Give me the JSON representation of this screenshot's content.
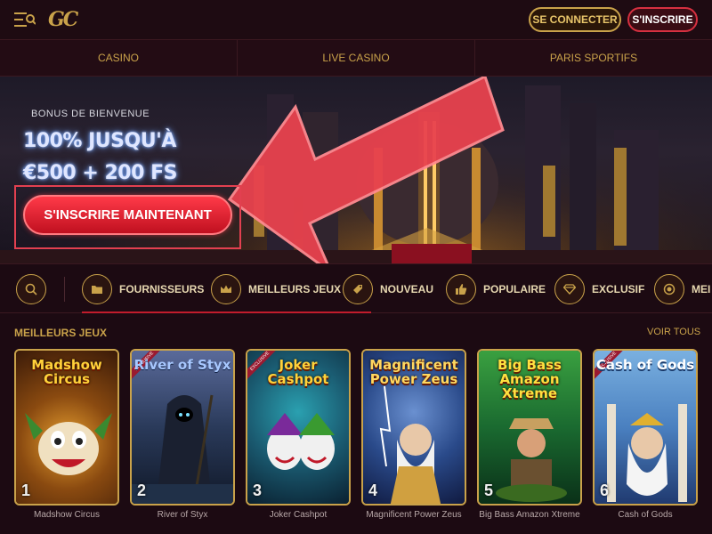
{
  "header": {
    "login_label": "SE CONNECTER",
    "signup_label": "S'INSCRIRE",
    "logo_text": "GC",
    "menu_icon": "menu-icon",
    "colors": {
      "gold": "#c9a24a",
      "red": "#d63040",
      "bg": "#1c0a12"
    }
  },
  "main_nav": {
    "tabs": [
      {
        "label": "CASINO"
      },
      {
        "label": "LIVE CASINO"
      },
      {
        "label": "PARIS SPORTIFS"
      }
    ]
  },
  "hero": {
    "bonus_label": "BONUS DE BIENVENUE",
    "headline_1": "100% JUSQU'À",
    "headline_2": "€500 + 200 FS",
    "cta_label": "S'INSCRIRE MAINTENANT"
  },
  "categories": {
    "search_icon": "search-icon",
    "items": [
      {
        "label": "FOURNISSEURS",
        "icon": "folder-icon"
      },
      {
        "label": "MEILLEURS JEUX",
        "icon": "crown-icon"
      },
      {
        "label": "NOUVEAU",
        "icon": "tag-icon"
      },
      {
        "label": "POPULAIRE",
        "icon": "thumbs-up-icon"
      },
      {
        "label": "EXCLUSIF",
        "icon": "diamond-icon"
      },
      {
        "label": "MEI",
        "icon": "chip-icon"
      }
    ]
  },
  "games": {
    "section_title": "MEILLEURS JEUX",
    "see_all_label": "VOIR TOUS",
    "items": [
      {
        "rank": "1",
        "name": "Madshow Circus",
        "art_title": "Madshow Circus"
      },
      {
        "rank": "2",
        "name": "River of Styx",
        "art_title": "River of Styx"
      },
      {
        "rank": "3",
        "name": "Joker Cashpot",
        "art_title": "Joker Cashpot"
      },
      {
        "rank": "4",
        "name": "Magnificent Power Zeus",
        "art_title": "Magnificent Power Zeus"
      },
      {
        "rank": "5",
        "name": "Big Bass Amazon Xtreme",
        "art_title": "Big Bass Amazon Xtreme"
      },
      {
        "rank": "6",
        "name": "Cash of Gods",
        "art_title": "Cash of Gods"
      }
    ]
  }
}
